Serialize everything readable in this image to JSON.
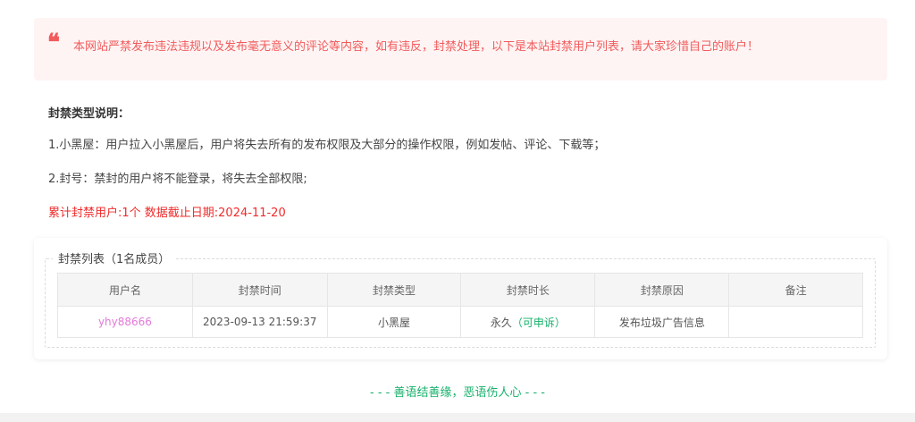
{
  "notice": {
    "icon": "quote-icon",
    "text": "本网站严禁发布违法违规以及发布毫无意义的评论等内容，如有违反，封禁处理，以下是本站封禁用户列表，请大家珍惜自己的账户！"
  },
  "description": {
    "title": "封禁类型说明：",
    "lines": [
      "1.小黑屋：用户拉入小黑屋后，用户将失去所有的发布权限及大部分的操作权限，例如发帖、评论、下载等；",
      "2.封号：禁封的用户将不能登录，将失去全部权限;"
    ],
    "stats": "累计封禁用户:1个 数据截止日期:2024-11-20"
  },
  "ban_list": {
    "legend": "封禁列表（1名成员）",
    "columns": [
      "用户名",
      "封禁时间",
      "封禁类型",
      "封禁时长",
      "封禁原因",
      "备注"
    ],
    "rows": [
      {
        "username": "yhy88666",
        "time": "2023-09-13 21:59:37",
        "type": "小黑屋",
        "duration": "永久",
        "appeal": "（可申诉）",
        "reason": "发布垃圾广告信息",
        "note": ""
      }
    ]
  },
  "footer": {
    "motto": "- - - 善语结善缘，恶语伤人心 - - -"
  },
  "colors": {
    "notice_text": "#f15b5b",
    "stats_text": "#f02b2b",
    "username_link": "#e27ad9",
    "accent_green": "#15b06a"
  }
}
